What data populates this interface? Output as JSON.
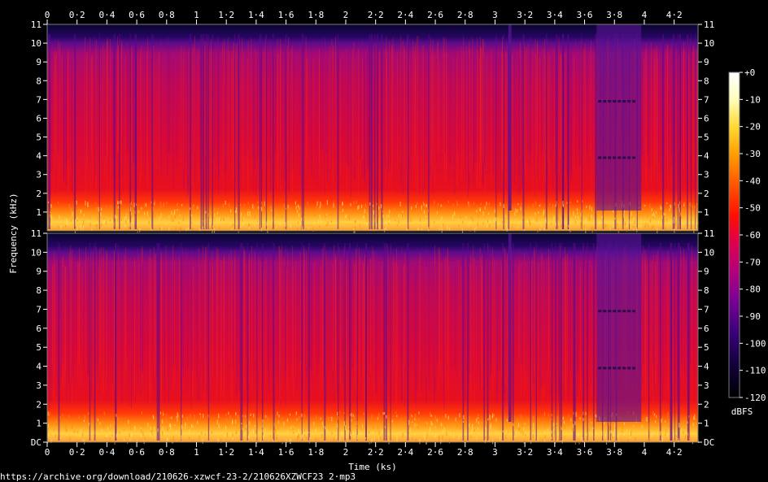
{
  "chart_data": {
    "type": "heatmap",
    "source": "https://archive·org/download/210626-xzwcf-23-2/210626XZWCF23 2·mp3",
    "xlabel": "Time (ks)",
    "ylabel": "Frequency (kHz)",
    "colorbar_label": "dBFS",
    "x_ticks": [
      "0",
      "0·2",
      "0·4",
      "0·6",
      "0·8",
      "1",
      "1·2",
      "1·4",
      "1·6",
      "1·8",
      "2",
      "2·2",
      "2·4",
      "2·6",
      "2·8",
      "3",
      "3·2",
      "3·4",
      "3·6",
      "3·8",
      "4",
      "4·2"
    ],
    "x_tick_values": [
      0,
      0.2,
      0.4,
      0.6,
      0.8,
      1,
      1.2,
      1.4,
      1.6,
      1.8,
      2,
      2.2,
      2.4,
      2.6,
      2.8,
      3,
      3.2,
      3.4,
      3.6,
      3.8,
      4,
      4.2
    ],
    "xlim": [
      0,
      4.36
    ],
    "ylim": [
      0,
      11
    ],
    "panels": [
      {
        "channel": "upper",
        "y_ticks": [
          "1",
          "2",
          "3",
          "4",
          "5",
          "6",
          "7",
          "8",
          "9",
          "10",
          "11"
        ],
        "y_tick_values": [
          1,
          2,
          3,
          4,
          5,
          6,
          7,
          8,
          9,
          10,
          11
        ]
      },
      {
        "channel": "lower",
        "y_ticks": [
          "DC",
          "1",
          "2",
          "3",
          "4",
          "5",
          "6",
          "7",
          "8",
          "9",
          "10",
          "11"
        ],
        "y_tick_values": [
          0,
          1,
          2,
          3,
          4,
          5,
          6,
          7,
          8,
          9,
          10,
          11
        ]
      }
    ],
    "colorbar_ticks": [
      "+0",
      "-10",
      "-20",
      "-30",
      "-40",
      "-50",
      "-60",
      "-70",
      "-80",
      "-90",
      "-100",
      "-110",
      "-120"
    ],
    "colorbar_values": [
      0,
      -10,
      -20,
      -30,
      -40,
      -50,
      -60,
      -70,
      -80,
      -90,
      -100,
      -110,
      -120
    ],
    "colorscale": [
      "#000000",
      "#12003a",
      "#3a0079",
      "#7a0096",
      "#b4007c",
      "#e0004a",
      "#ff1000",
      "#ff5200",
      "#ff9800",
      "#ffd830",
      "#ffffd0",
      "#ffffff"
    ],
    "dim_segments_ks": [
      [
        3.09,
        3.11
      ],
      [
        3.68,
        3.98
      ]
    ],
    "ridge_marks_khz": [
      3.9,
      6.9
    ]
  }
}
